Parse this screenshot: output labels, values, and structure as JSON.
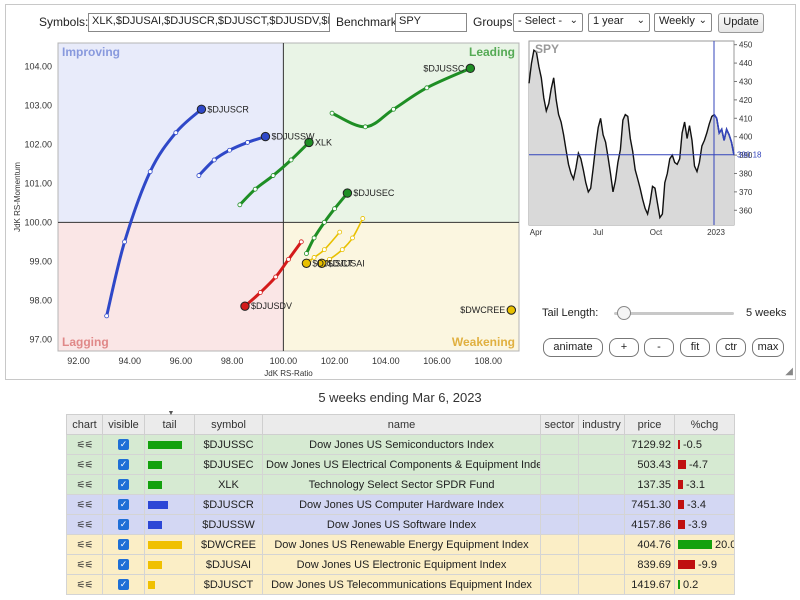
{
  "toolbar": {
    "symbols_label": "Symbols:",
    "symbols_value": "XLK,$DJUSAI,$DJUSCR,$DJUSCT,$DJUSDV,$DJ",
    "benchmark_label": "Benchmark:",
    "benchmark_value": "SPY",
    "groups_label": "Groups:",
    "groups_value": "- Select -",
    "period_value": "1 year",
    "frequency_value": "Weekly",
    "update_label": "Update"
  },
  "rrg": {
    "quadrants": {
      "improving": "Improving",
      "leading": "Leading",
      "lagging": "Lagging",
      "weakening": "Weakening"
    },
    "xlabel": "JdK RS-Ratio",
    "ylabel": "JdK RS-Momentum",
    "x_ticks": [
      "92.00",
      "94.00",
      "96.00",
      "98.00",
      "100.00",
      "102.00",
      "104.00",
      "106.00",
      "108.00"
    ],
    "y_ticks": [
      "104.00",
      "103.00",
      "102.00",
      "101.00",
      "100.00",
      "99.00",
      "98.00",
      "97.00"
    ],
    "colors": {
      "green": "#1e8e24",
      "blue": "#2f48c8",
      "red": "#d41b1b",
      "yellow": "#e8c000"
    }
  },
  "chart_data": {
    "type": "scatter",
    "xlabel": "JdK RS-Ratio",
    "ylabel": "JdK RS-Momentum",
    "xlim": [
      91.2,
      109.2
    ],
    "ylim": [
      96.7,
      104.6
    ],
    "series": [
      {
        "name": "$DJUSSC",
        "color": "green",
        "points": [
          [
            101.9,
            102.8
          ],
          [
            103.2,
            102.45
          ],
          [
            104.3,
            102.9
          ],
          [
            105.6,
            103.45
          ],
          [
            107.3,
            103.95
          ]
        ]
      },
      {
        "name": "$DJUSEC",
        "color": "green",
        "points": [
          [
            100.9,
            99.2
          ],
          [
            101.2,
            99.6
          ],
          [
            101.6,
            100.0
          ],
          [
            102.0,
            100.35
          ],
          [
            102.5,
            100.75
          ]
        ]
      },
      {
        "name": "XLK",
        "color": "green",
        "points": [
          [
            98.3,
            100.45
          ],
          [
            98.9,
            100.85
          ],
          [
            99.6,
            101.2
          ],
          [
            100.3,
            101.6
          ],
          [
            101.0,
            102.05
          ]
        ]
      },
      {
        "name": "$DJUSCR",
        "color": "blue",
        "points": [
          [
            93.1,
            97.6
          ],
          [
            93.8,
            99.5
          ],
          [
            94.8,
            101.3
          ],
          [
            95.8,
            102.3
          ],
          [
            96.8,
            102.9
          ]
        ]
      },
      {
        "name": "$DJUSSW",
        "color": "blue",
        "points": [
          [
            96.7,
            101.2
          ],
          [
            97.3,
            101.6
          ],
          [
            97.9,
            101.85
          ],
          [
            98.6,
            102.05
          ],
          [
            99.3,
            102.2
          ]
        ]
      },
      {
        "name": "$DJUSDV",
        "color": "red",
        "points": [
          [
            100.7,
            99.5
          ],
          [
            100.2,
            99.05
          ],
          [
            99.7,
            98.6
          ],
          [
            99.1,
            98.2
          ],
          [
            98.5,
            97.85
          ]
        ]
      },
      {
        "name": "$DJUSAI",
        "color": "yellow",
        "points": [
          [
            103.1,
            100.1
          ],
          [
            102.7,
            99.6
          ],
          [
            102.3,
            99.3
          ],
          [
            101.8,
            99.05
          ],
          [
            101.5,
            98.95
          ]
        ]
      },
      {
        "name": "$DJUSCT",
        "color": "yellow",
        "points": [
          [
            102.2,
            99.75
          ],
          [
            101.6,
            99.3
          ],
          [
            101.2,
            99.1
          ],
          [
            101.0,
            99.0
          ],
          [
            100.9,
            98.95
          ]
        ]
      },
      {
        "name": "$DWCREE",
        "color": "yellow",
        "points": [
          [
            108.9,
            97.75
          ]
        ]
      }
    ]
  },
  "benchmark_chart": {
    "type": "line",
    "title": "SPY",
    "y_ticks": [
      "450",
      "440",
      "430",
      "420",
      "410",
      "400",
      "390",
      "380",
      "370",
      "360"
    ],
    "x_ticks": [
      "Apr",
      "Jul",
      "Oct",
      "2023"
    ],
    "current_value": "390.18",
    "ylim": [
      352,
      452
    ],
    "values": [
      429,
      440,
      447,
      446,
      438,
      432,
      421,
      414,
      418,
      426,
      432,
      420,
      412,
      408,
      401,
      393,
      385,
      380,
      377,
      383,
      391,
      388,
      382,
      375,
      370,
      372,
      383,
      395,
      405,
      410,
      401,
      397,
      389,
      380,
      370,
      376,
      386,
      393,
      409,
      412,
      411,
      399,
      392,
      382,
      377,
      372,
      366,
      361,
      358,
      364,
      373,
      372,
      364,
      356,
      358,
      375,
      380,
      388,
      390,
      386,
      385,
      388,
      402,
      408,
      399,
      406,
      398,
      384,
      381,
      386,
      395,
      398,
      402,
      407,
      411,
      412,
      410,
      402,
      404,
      398,
      404,
      401,
      397,
      390
    ]
  },
  "controls": {
    "tail_length_label": "Tail Length:",
    "tail_length_value": "5 weeks",
    "tail_length_fraction": 0.05,
    "buttons": [
      "animate",
      "+",
      "-",
      "fit",
      "ctr",
      "max"
    ]
  },
  "caption": "5 weeks ending Mar 6, 2023",
  "table": {
    "headers": [
      "chart",
      "visible",
      "tail",
      "symbol",
      "name",
      "sector",
      "industry",
      "price",
      "%chg"
    ],
    "rows": [
      {
        "symbol": "$DJUSSC",
        "name": "Dow Jones US Semiconductors Index",
        "sector": "",
        "industry": "",
        "price": "7129.92",
        "chg": "-0.5",
        "chg_value": -0.5,
        "tail_weeks": 5,
        "color": "green"
      },
      {
        "symbol": "$DJUSEC",
        "name": "Dow Jones US Electrical Components & Equipment Index",
        "sector": "",
        "industry": "",
        "price": "503.43",
        "chg": "-4.7",
        "chg_value": -4.7,
        "tail_weeks": 2,
        "color": "green"
      },
      {
        "symbol": "XLK",
        "name": "Technology Select Sector SPDR Fund",
        "sector": "",
        "industry": "",
        "price": "137.35",
        "chg": "-3.1",
        "chg_value": -3.1,
        "tail_weeks": 2,
        "color": "green"
      },
      {
        "symbol": "$DJUSCR",
        "name": "Dow Jones US Computer Hardware Index",
        "sector": "",
        "industry": "",
        "price": "7451.30",
        "chg": "-3.4",
        "chg_value": -3.4,
        "tail_weeks": 3,
        "color": "blue"
      },
      {
        "symbol": "$DJUSSW",
        "name": "Dow Jones US Software Index",
        "sector": "",
        "industry": "",
        "price": "4157.86",
        "chg": "-3.9",
        "chg_value": -3.9,
        "tail_weeks": 2,
        "color": "blue"
      },
      {
        "symbol": "$DWCREE",
        "name": "Dow Jones US Renewable Energy Equipment Index",
        "sector": "",
        "industry": "",
        "price": "404.76",
        "chg": "20.0",
        "chg_value": 20.0,
        "tail_weeks": 5,
        "color": "yellow"
      },
      {
        "symbol": "$DJUSAI",
        "name": "Dow Jones US Electronic Equipment Index",
        "sector": "",
        "industry": "",
        "price": "839.69",
        "chg": "-9.9",
        "chg_value": -9.9,
        "tail_weeks": 2,
        "color": "yellow"
      },
      {
        "symbol": "$DJUSCT",
        "name": "Dow Jones US Telecommunications Equipment Index",
        "sector": "",
        "industry": "",
        "price": "1419.67",
        "chg": "0.2",
        "chg_value": 0.2,
        "tail_weeks": 1,
        "color": "yellow"
      }
    ]
  }
}
